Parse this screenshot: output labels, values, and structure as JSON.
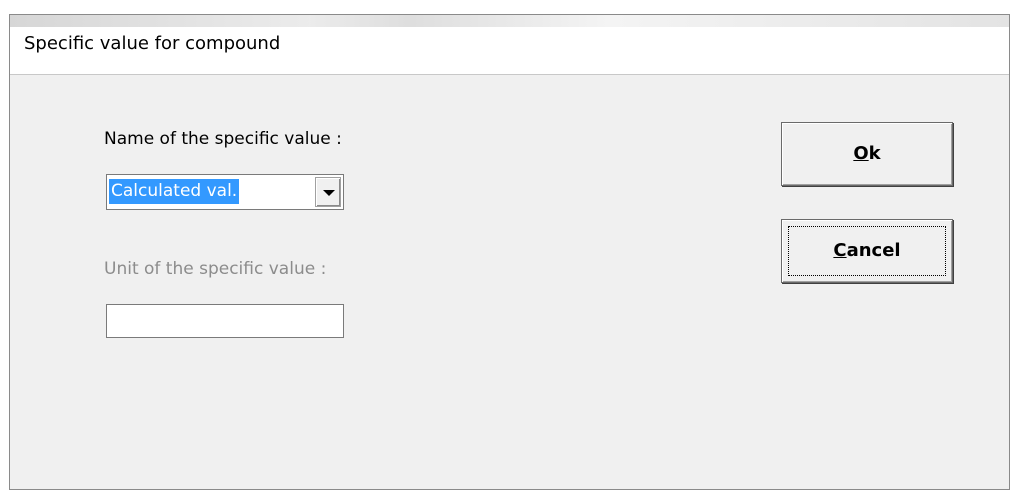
{
  "dialog": {
    "title": "Specific value for compound"
  },
  "form": {
    "name_label": "Name of the specific value :",
    "name_selected": "Calculated val.",
    "unit_label": "Unit of the specific value :",
    "unit_value": ""
  },
  "buttons": {
    "ok": {
      "accel": "O",
      "rest": "k"
    },
    "cancel": {
      "accel": "C",
      "rest": "ancel"
    }
  },
  "colors": {
    "selection": "#3399ff",
    "dialog_bg": "#f0f0f0",
    "disabled_text": "#8c8c8c"
  }
}
